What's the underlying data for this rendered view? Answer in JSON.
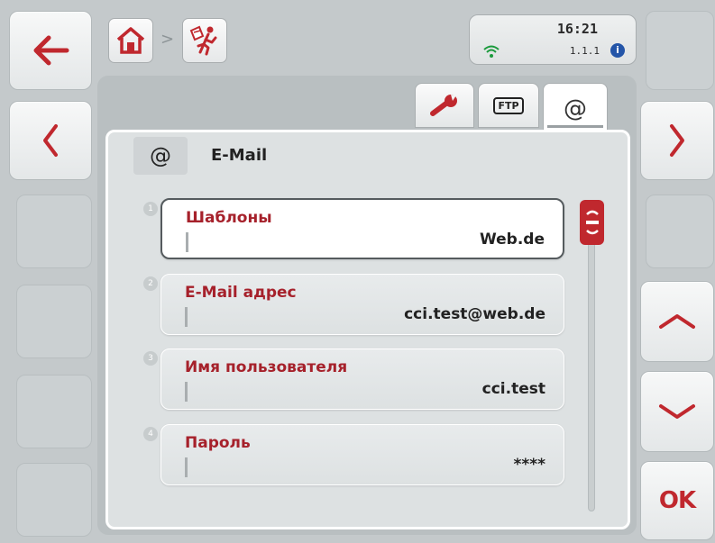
{
  "header": {
    "time": "16:21",
    "version": "1.1.1",
    "info_badge": "i",
    "crumb_separator": ">",
    "icons": [
      "home-icon",
      "running-man-icon",
      "wifi-icon"
    ]
  },
  "tabs": [
    {
      "name": "settings",
      "icon": "wrench-icon"
    },
    {
      "name": "ftp",
      "label": "FTP"
    },
    {
      "name": "email",
      "label": "@",
      "active": true
    }
  ],
  "page": {
    "title_icon": "@",
    "title": "E-Mail"
  },
  "rows": [
    {
      "number": "1",
      "label": "Шаблоны",
      "value": "Web.de",
      "selected": true
    },
    {
      "number": "2",
      "label": "E-Mail адрес",
      "value": "cci.test@web.de"
    },
    {
      "number": "3",
      "label": "Имя пользователя",
      "value": "cci.test"
    },
    {
      "number": "4",
      "label": "Пароль",
      "value": "****"
    }
  ],
  "softkeys": {
    "ok_label": "OK",
    "left": [
      "back-arrow-icon",
      "page-left-icon"
    ],
    "right": [
      "page-right-icon",
      "scroll-up-icon",
      "scroll-down-icon"
    ]
  },
  "colors": {
    "accent_red": "#c0282e",
    "label_red": "#a6212b",
    "background": "#c4c9cb",
    "info_blue": "#2455a8",
    "wifi_green": "#1b9a3c"
  }
}
